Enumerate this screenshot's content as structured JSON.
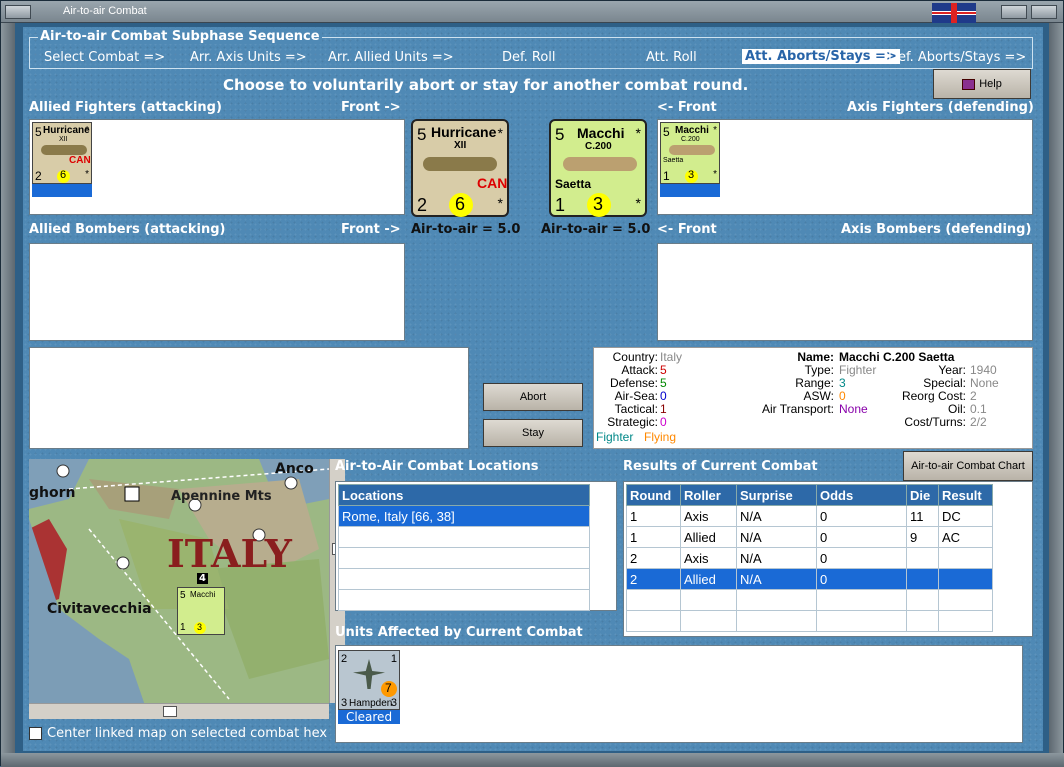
{
  "window": {
    "title": "Air-to-air Combat"
  },
  "sequence": {
    "title": "Air-to-air Combat Subphase Sequence",
    "steps": [
      "Select Combat =>",
      "Arr. Axis Units =>",
      "Arr. Allied Units =>",
      "Def. Roll",
      "Att. Roll",
      "Att. Aborts/Stays =>",
      "Def. Aborts/Stays =>"
    ],
    "active_index": 5
  },
  "instruction": "Choose to voluntarily abort or stay for another combat round.",
  "help_button": "Help",
  "labels": {
    "allied_fighters": "Allied Fighters (attacking)",
    "front_right": "Front ->",
    "front_left": "<- Front",
    "axis_fighters": "Axis Fighters (defending)",
    "allied_bombers": "Allied Bombers (attacking)",
    "axis_bombers": "Axis Bombers (defending)",
    "allied_a2a": "Air-to-air = 5.0",
    "axis_a2a": "Air-to-air = 5.0"
  },
  "allied_unit": {
    "name": "Hurricane",
    "variant": "XII",
    "nation": "CAN",
    "top_left": "5",
    "top_right": "*",
    "bottom_left": "2",
    "air": "6",
    "bottom_right": "*"
  },
  "axis_unit": {
    "name": "Macchi",
    "variant": "C.200",
    "nickname": "Saetta",
    "top_left": "5",
    "top_right": "*",
    "bottom_left": "1",
    "air": "3",
    "bottom_right": "*"
  },
  "buttons": {
    "abort": "Abort",
    "stay": "Stay",
    "chart": "Air-to-air Combat Chart"
  },
  "unit_info": {
    "left": [
      {
        "label": "Country:",
        "value": "Italy",
        "color": "#888888"
      },
      {
        "label": "Attack:",
        "value": "5",
        "color": "#cc0000"
      },
      {
        "label": "Defense:",
        "value": "5",
        "color": "#008800"
      },
      {
        "label": "Air-Sea:",
        "value": "0",
        "color": "#0000cc"
      },
      {
        "label": "Tactical:",
        "value": "1",
        "color": "#880000"
      },
      {
        "label": "Strategic:",
        "value": "0",
        "color": "#cc00cc"
      }
    ],
    "status1": "Fighter",
    "status2": "Flying",
    "name_label": "Name:",
    "name_value": "Macchi C.200 Saetta",
    "mid": [
      {
        "label": "Type:",
        "value": "Fighter",
        "color": "#888888"
      },
      {
        "label": "Range:",
        "value": "3",
        "color": "#008888"
      },
      {
        "label": "ASW:",
        "value": "0",
        "color": "#ff8800"
      },
      {
        "label": "Air Transport:",
        "value": "None",
        "color": "#8800aa"
      }
    ],
    "right": [
      {
        "label": "Year:",
        "value": "1940"
      },
      {
        "label": "Special:",
        "value": "None"
      },
      {
        "label": "Reorg Cost:",
        "value": "2"
      },
      {
        "label": "Oil:",
        "value": "0.1"
      },
      {
        "label": "Cost/Turns:",
        "value": "2/2"
      }
    ]
  },
  "map": {
    "labels": [
      "Anco",
      "ghorn",
      "Apennine Mts",
      "ITALY",
      "Civitavecchia"
    ],
    "stack_count": "4"
  },
  "center_checkbox": "Center linked map on selected combat hex",
  "locations": {
    "title": "Air-to-Air Combat Locations",
    "header": "Locations",
    "rows": [
      "Rome, Italy [66, 38]"
    ]
  },
  "results": {
    "title": "Results of Current Combat",
    "headers": [
      "Round",
      "Roller",
      "Surprise",
      "Odds",
      "Die",
      "Result"
    ],
    "rows": [
      [
        "1",
        "Axis",
        "N/A",
        "0",
        "11",
        "DC"
      ],
      [
        "1",
        "Allied",
        "N/A",
        "0",
        "9",
        "AC"
      ],
      [
        "2",
        "Axis",
        "N/A",
        "0",
        "",
        ""
      ],
      [
        "2",
        "Allied",
        "N/A",
        "0",
        "",
        ""
      ]
    ],
    "selected": 3
  },
  "affected": {
    "title": "Units Affected by Current Combat",
    "unit": {
      "name": "Hampden",
      "tl": "2",
      "tr": "1",
      "bl": "3",
      "br": "3",
      "air": "7",
      "status": "Cleared"
    }
  },
  "colors": {
    "accent": "#2864a8",
    "selection": "#1a6ad6"
  }
}
